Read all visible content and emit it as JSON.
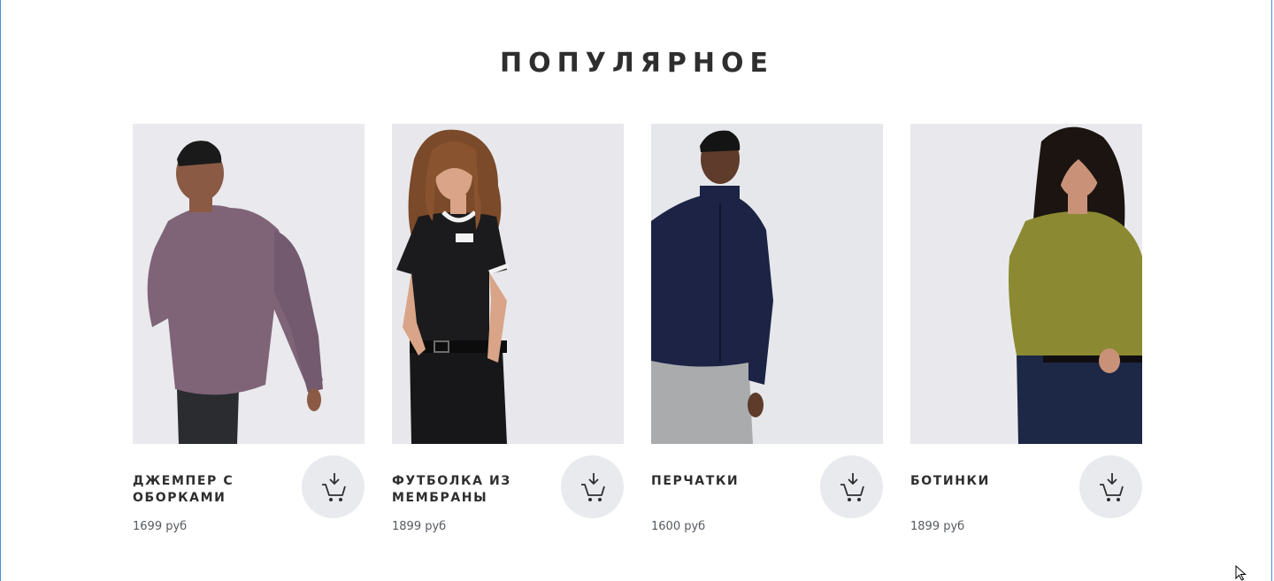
{
  "section": {
    "title": "ПОПУЛЯРНОЕ"
  },
  "products": [
    {
      "name": "ДЖЕМПЕР С ОБОРКАМИ",
      "price": "1699 руб",
      "image_alt": "man in mauve long-sleeve jumper",
      "garment_color": "#7f6478",
      "skin_color": "#8a5a44",
      "pants_color": "#2a2c30",
      "cart_icon": "download-to-cart-icon"
    },
    {
      "name": "ФУТБОЛКА ИЗ МЕМБРАНЫ",
      "price": "1899 руб",
      "image_alt": "woman in black ringer t-shirt",
      "garment_color": "#1b1b1d",
      "skin_color": "#d9a487",
      "pants_color": "#17171a",
      "cart_icon": "download-to-cart-icon"
    },
    {
      "name": "ПЕРЧАТКИ",
      "price": "1600 руб",
      "image_alt": "man in navy zip cardigan",
      "garment_color": "#1c2344",
      "skin_color": "#5e3b2a",
      "pants_color": "#a9abad",
      "cart_icon": "download-to-cart-icon"
    },
    {
      "name": "БОТИНКИ",
      "price": "1899 руб",
      "image_alt": "woman in olive knit sweater",
      "garment_color": "#8b8a32",
      "skin_color": "#c99278",
      "pants_color": "#1d2746",
      "cart_icon": "download-to-cart-icon"
    }
  ],
  "colors": {
    "text": "#2e2e2e",
    "price": "#555a60",
    "photo_bg": "#e7e8ec",
    "button_bg": "#e8eaee"
  }
}
